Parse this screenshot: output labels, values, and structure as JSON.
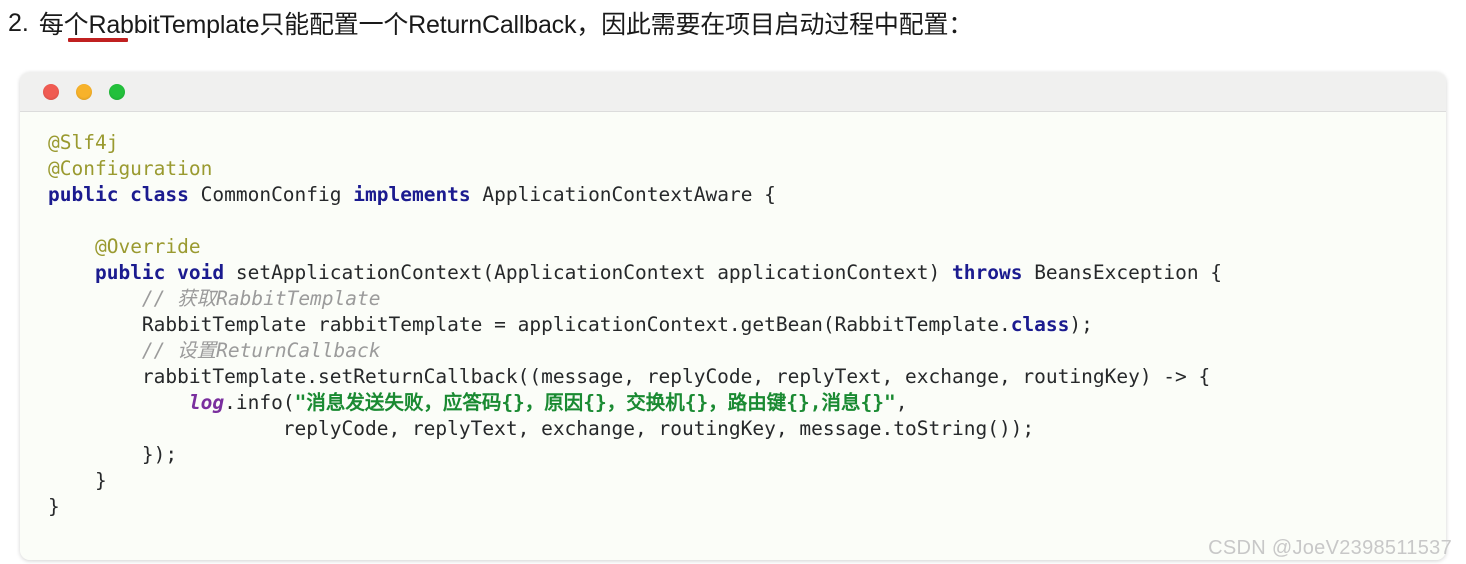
{
  "heading": {
    "number": "2.",
    "text": "每个RabbitTemplate只能配置一个ReturnCallback，因此需要在项目启动过程中配置：",
    "underline_color": "#c02020"
  },
  "code_window": {
    "titlebar": {
      "close_label": "close",
      "minimize_label": "minimize",
      "maximize_label": "maximize",
      "close_color": "#f05b52",
      "minimize_color": "#f7b22a",
      "maximize_color": "#23c03b"
    },
    "language": "java",
    "background": "#fbfdf8",
    "colors": {
      "annotation": "#9a9a30",
      "keyword": "#1b1b8f",
      "plain": "#26282a",
      "comment": "#9b9b9b",
      "string": "#1a8a32",
      "field": "#7a2f9e"
    },
    "lines": [
      [
        {
          "t": "annotation",
          "s": "@Slf4j"
        }
      ],
      [
        {
          "t": "annotation",
          "s": "@Configuration"
        }
      ],
      [
        {
          "t": "keyword",
          "s": "public class"
        },
        {
          "t": "plain",
          "s": " CommonConfig "
        },
        {
          "t": "keyword",
          "s": "implements"
        },
        {
          "t": "plain",
          "s": " ApplicationContextAware {"
        }
      ],
      [
        {
          "t": "plain",
          "s": ""
        }
      ],
      [
        {
          "t": "plain",
          "s": "    "
        },
        {
          "t": "annotation",
          "s": "@Override"
        }
      ],
      [
        {
          "t": "plain",
          "s": "    "
        },
        {
          "t": "keyword",
          "s": "public void"
        },
        {
          "t": "plain",
          "s": " setApplicationContext(ApplicationContext applicationContext) "
        },
        {
          "t": "keyword",
          "s": "throws"
        },
        {
          "t": "plain",
          "s": " BeansException {"
        }
      ],
      [
        {
          "t": "plain",
          "s": "        "
        },
        {
          "t": "comment",
          "s": "// 获取RabbitTemplate"
        }
      ],
      [
        {
          "t": "plain",
          "s": "        RabbitTemplate rabbitTemplate = applicationContext.getBean(RabbitTemplate."
        },
        {
          "t": "keyword",
          "s": "class"
        },
        {
          "t": "plain",
          "s": ");"
        }
      ],
      [
        {
          "t": "plain",
          "s": "        "
        },
        {
          "t": "comment",
          "s": "// 设置ReturnCallback"
        }
      ],
      [
        {
          "t": "plain",
          "s": "        rabbitTemplate.setReturnCallback((message, replyCode, replyText, exchange, routingKey) -> {"
        }
      ],
      [
        {
          "t": "plain",
          "s": "            "
        },
        {
          "t": "field",
          "s": "log"
        },
        {
          "t": "plain",
          "s": ".info("
        },
        {
          "t": "string",
          "s": "\"消息发送失败，应答码{}，原因{}，交换机{}，路由键{},消息{}\""
        },
        {
          "t": "plain",
          "s": ","
        }
      ],
      [
        {
          "t": "plain",
          "s": "                    replyCode, replyText, exchange, routingKey, message.toString());"
        }
      ],
      [
        {
          "t": "plain",
          "s": "        });"
        }
      ],
      [
        {
          "t": "plain",
          "s": "    }"
        }
      ],
      [
        {
          "t": "plain",
          "s": "}"
        }
      ]
    ]
  },
  "watermark": {
    "text": "CSDN @JoeV2398511537"
  }
}
